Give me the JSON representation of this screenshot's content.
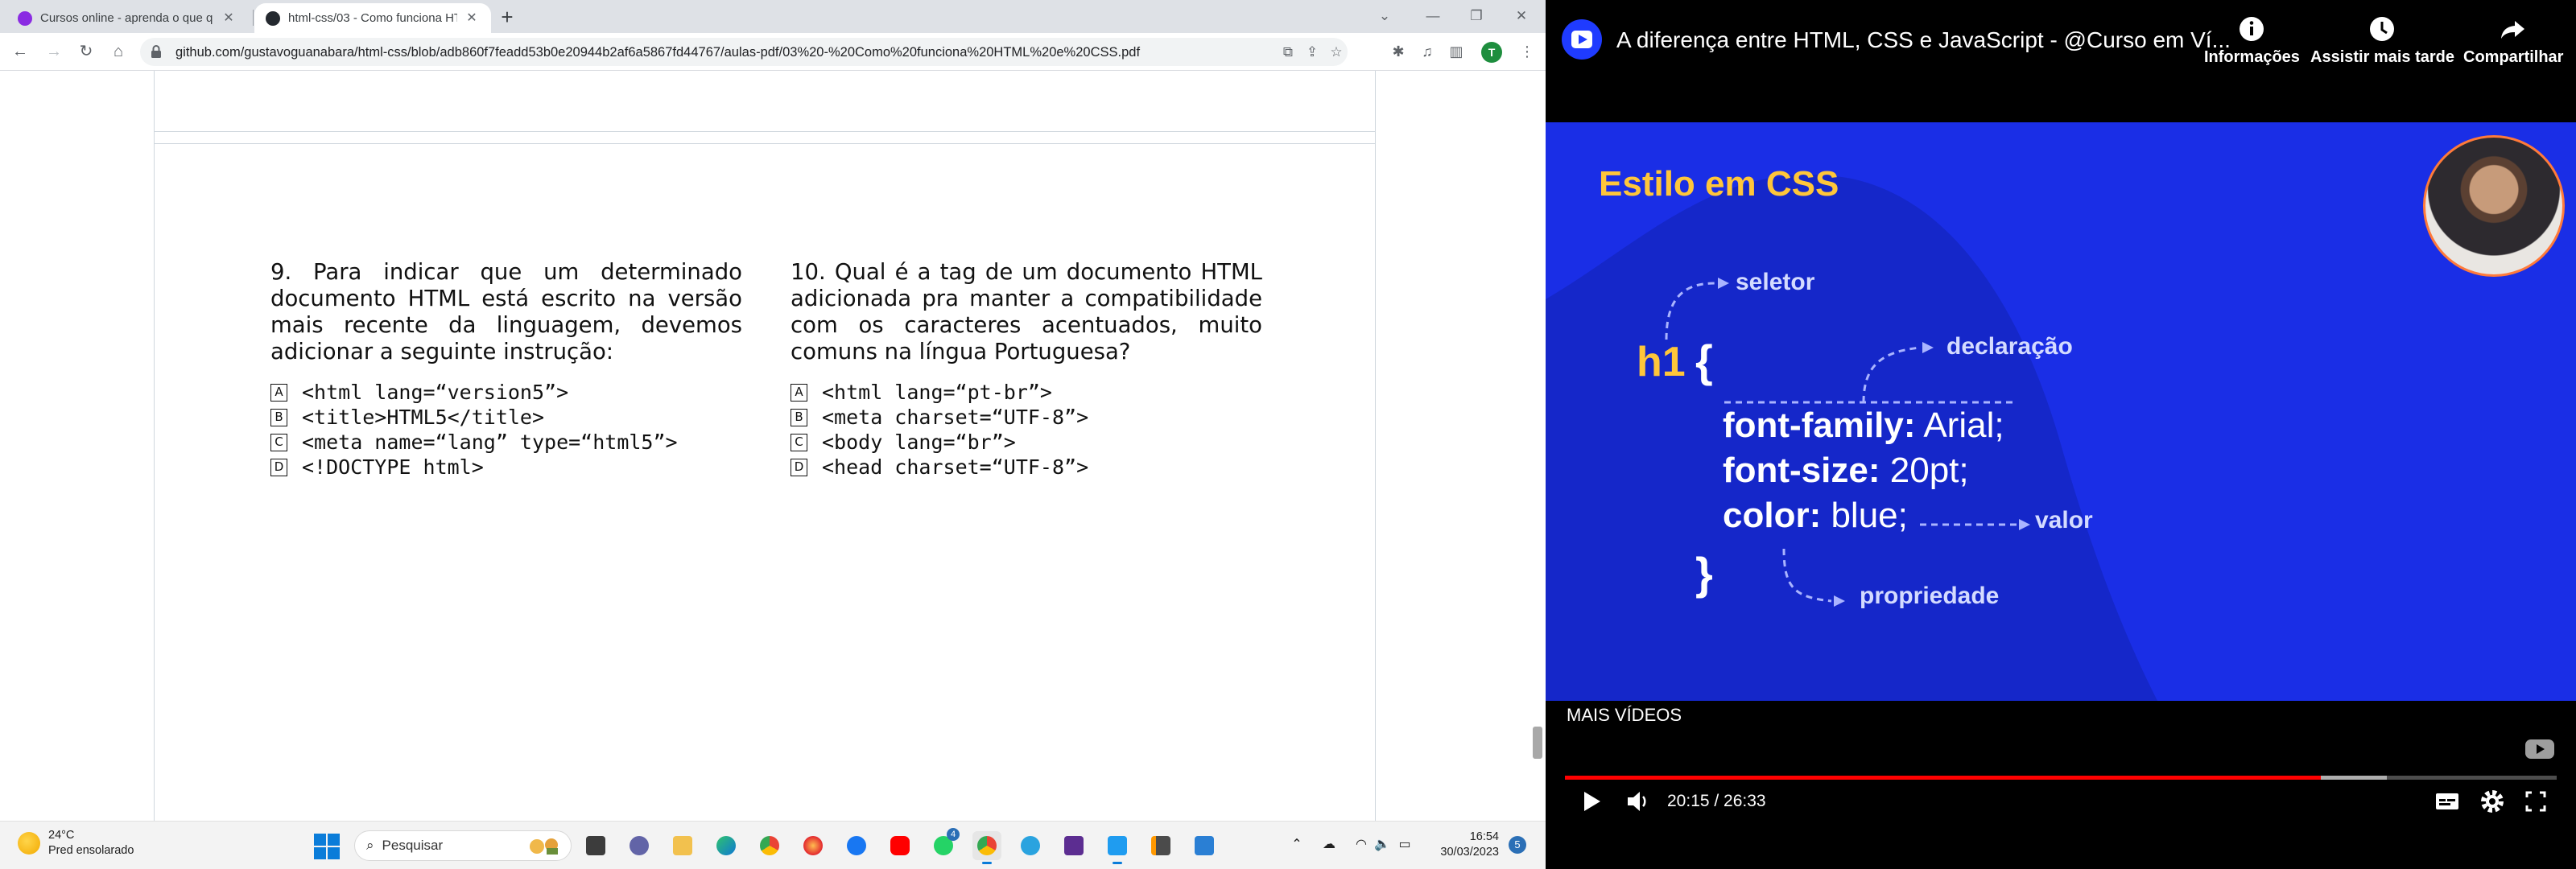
{
  "browser": {
    "tabs": [
      {
        "title": "Cursos online - aprenda o que q",
        "active": false,
        "favicon_color": "#8a2be2"
      },
      {
        "title": "html-css/03 - Como funciona HT",
        "active": true,
        "favicon_color": "#24292f"
      }
    ],
    "url": "github.com/gustavoguanabara/html-css/blob/adb860f7feadd53b0e20944b2af6a5867fd44767/aulas-pdf/03%20-%20Como%20funciona%20HTML%20e%20CSS.pdf",
    "profile_initial": "T"
  },
  "pdf": {
    "q9": {
      "text": "9. Para indicar que um determinado documento HTML está escrito na versão mais recente da linguagem, devemos adicionar a seguinte instrução:",
      "options": [
        {
          "letter": "A",
          "code": "<html lang=“version5”>"
        },
        {
          "letter": "B",
          "code": "<title>HTML5</title>"
        },
        {
          "letter": "C",
          "code": "<meta name=“lang” type=“html5”>"
        },
        {
          "letter": "D",
          "code": "<!DOCTYPE html>"
        }
      ]
    },
    "q10": {
      "text": "10. Qual é a tag de um documento HTML adicionada pra manter a compatibilidade com os caracteres acentuados, muito comuns na língua Portuguesa?",
      "options": [
        {
          "letter": "A",
          "code": "<html lang=“pt-br”>"
        },
        {
          "letter": "B",
          "code": "<meta charset=“UTF-8”>"
        },
        {
          "letter": "C",
          "code": "<body lang=“br”>"
        },
        {
          "letter": "D",
          "code": "<head charset=“UTF-8”>"
        }
      ]
    }
  },
  "taskbar": {
    "weather_temp": "24°C",
    "weather_desc": "Pred ensolarado",
    "search_placeholder": "Pesquisar",
    "time": "16:54",
    "date": "30/03/2023",
    "notification_count": "5",
    "whatsapp_badge": "4"
  },
  "player": {
    "title": "A diferença entre HTML, CSS e JavaScript - @Curso em Ví...",
    "actions": [
      {
        "label": "Informações",
        "icon": "info-icon"
      },
      {
        "label": "Assistir mais tarde",
        "icon": "clock-icon"
      },
      {
        "label": "Compartilhar",
        "icon": "share-icon"
      }
    ],
    "slide": {
      "title": "Estilo em CSS",
      "selector": "h1",
      "open_brace": "{",
      "close_brace": "}",
      "lines": [
        {
          "prop": "font-family:",
          "value": " Arial;"
        },
        {
          "prop": "font-size:",
          "value": " 20pt;"
        },
        {
          "prop": "color:",
          "value": " blue;"
        }
      ],
      "annotations": {
        "selector": "seletor",
        "declaration": "declaração",
        "value": "valor",
        "property": "propriedade"
      },
      "colors": {
        "background": "#1a2ee6",
        "accent": "#ffc63a"
      }
    },
    "more_videos": "MAIS VÍDEOS",
    "time_display": "20:15 / 26:33",
    "progress_played": 0.7625,
    "progress_buffered": 0.829
  }
}
